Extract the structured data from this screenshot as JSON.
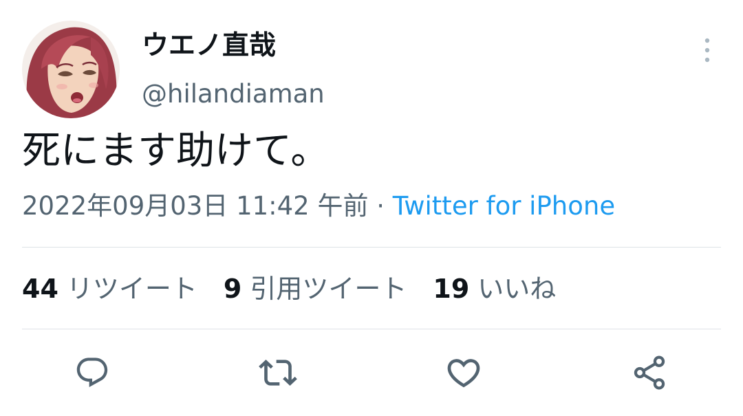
{
  "user": {
    "display_name": "ウエノ直哉",
    "handle": "@hilandiaman",
    "avatar_icon": "user-avatar"
  },
  "tweet": {
    "text": "死にます助けて。",
    "timestamp": "2022年09月03日 11:42 午前",
    "separator": "·",
    "source": "Twitter for iPhone"
  },
  "stats": {
    "retweets_count": "44",
    "retweets_label": "リツイート",
    "quotes_count": "9",
    "quotes_label": "引用ツイート",
    "likes_count": "19",
    "likes_label": "いいね"
  },
  "actions": {
    "reply_icon": "reply-icon",
    "retweet_icon": "retweet-icon",
    "like_icon": "heart-icon",
    "share_icon": "share-icon"
  },
  "colors": {
    "text_primary": "#0f1419",
    "text_secondary": "#536471",
    "link": "#1d9bf0",
    "divider": "#dde2e6",
    "icon": "#536471"
  }
}
